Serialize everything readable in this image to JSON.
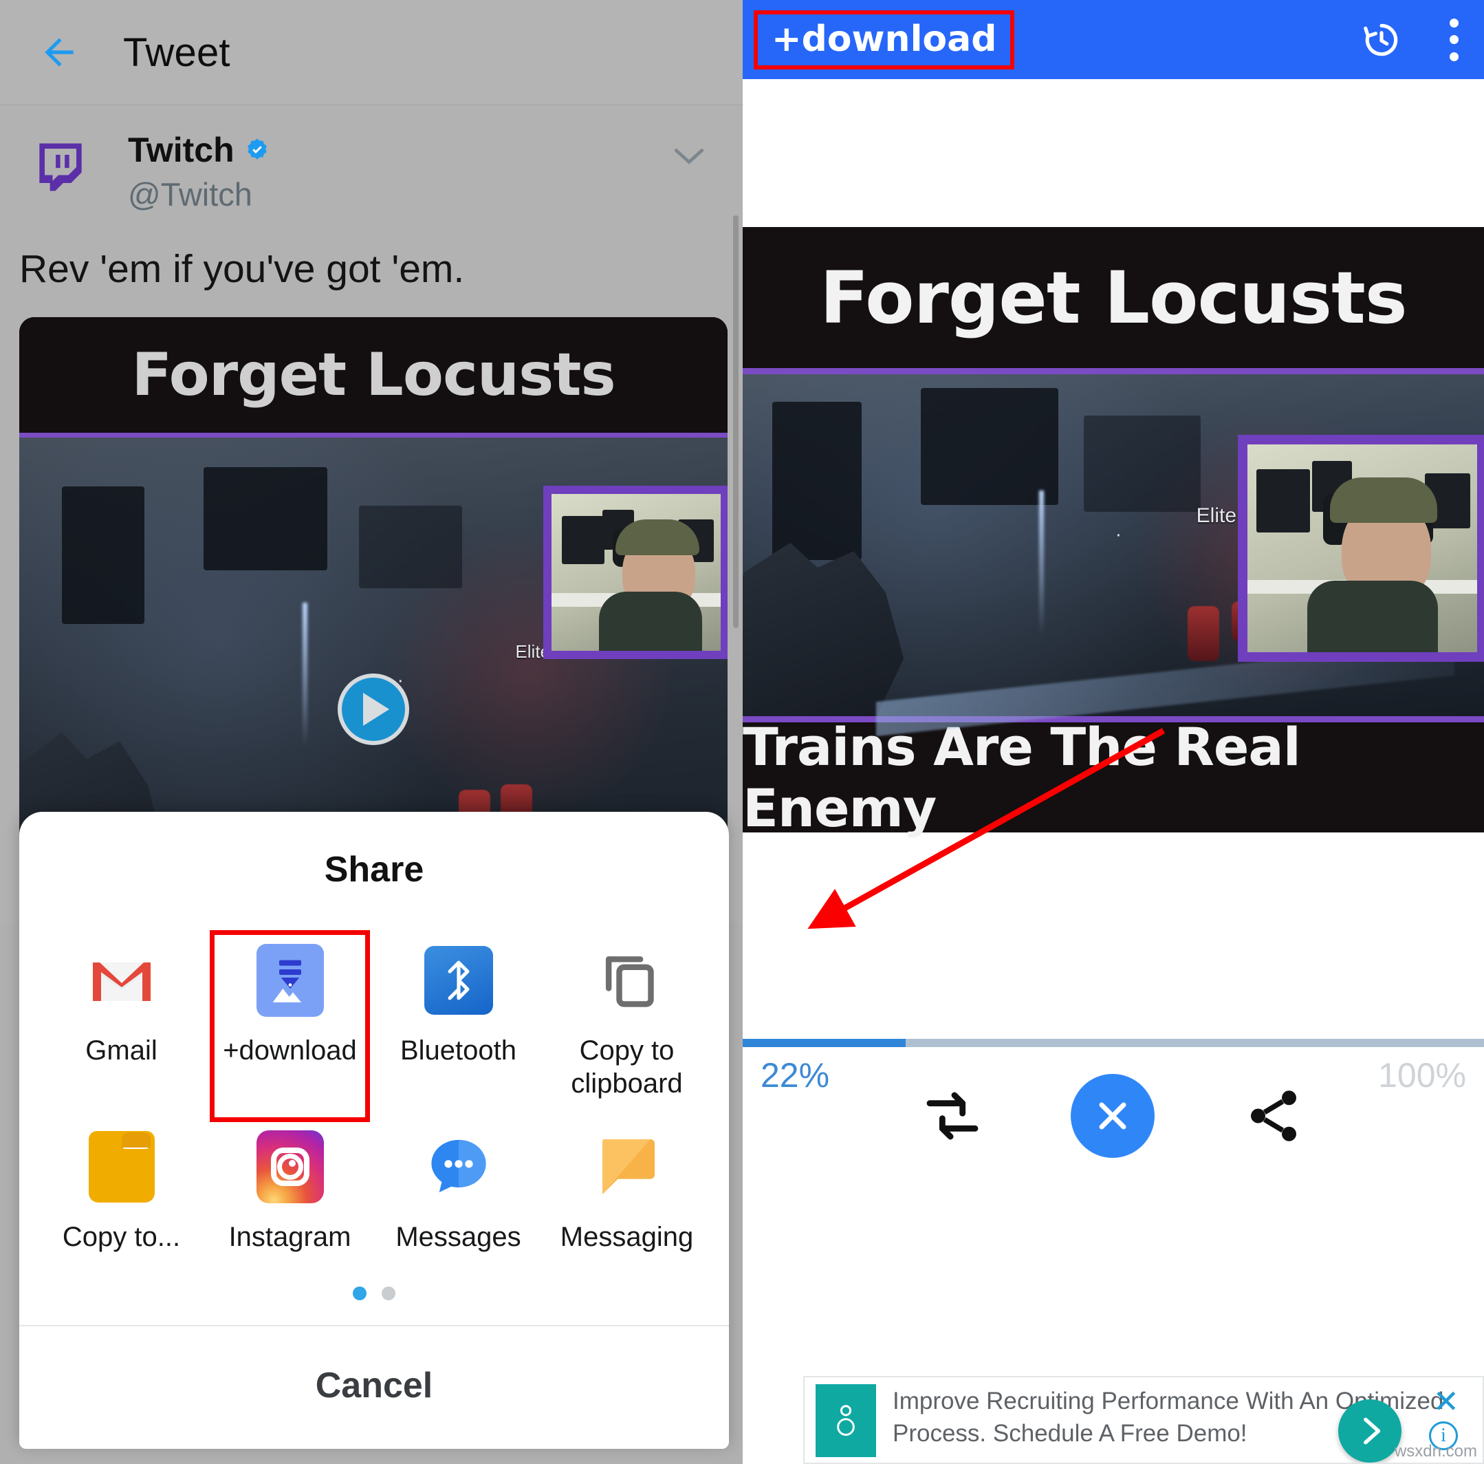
{
  "left_panel": {
    "appbar": {
      "back_icon": "back-arrow-icon",
      "title": "Tweet"
    },
    "tweet": {
      "avatar_icon": "twitch-logo-icon",
      "display_name": "Twitch",
      "verified_icon": "verified-badge-icon",
      "handle": "@Twitch",
      "overflow_icon": "chevron-down-icon",
      "text": "Rev 'em if you've got 'em.",
      "media": {
        "caption_top": "Forget Locusts",
        "overlay_label": "Elite D",
        "play_icon": "play-button-icon"
      }
    },
    "share_sheet": {
      "title": "Share",
      "items": [
        {
          "label": "Gmail",
          "icon": "gmail-icon",
          "highlighted": false
        },
        {
          "label": "+download",
          "icon": "plus-download-icon",
          "highlighted": true
        },
        {
          "label": "Bluetooth",
          "icon": "bluetooth-icon",
          "highlighted": false
        },
        {
          "label": "Copy to clipboard",
          "icon": "copy-to-clipboard-icon",
          "highlighted": false
        },
        {
          "label": "Copy to...",
          "icon": "folder-icon",
          "highlighted": false
        },
        {
          "label": "Instagram",
          "icon": "instagram-icon",
          "highlighted": false
        },
        {
          "label": "Messages",
          "icon": "messages-icon",
          "highlighted": false
        },
        {
          "label": "Messaging",
          "icon": "messaging-icon",
          "highlighted": false
        }
      ],
      "pagination": {
        "pages": 2,
        "active_index": 0
      },
      "cancel_label": "Cancel"
    }
  },
  "right_panel": {
    "appbar": {
      "title": "+download",
      "title_highlighted": true,
      "history_icon": "history-clock-icon",
      "menu_icon": "kebab-menu-icon"
    },
    "media": {
      "caption_top": "Forget Locusts",
      "caption_bottom": "Trains Are The Real Enemy",
      "overlay_label": "Elite D"
    },
    "download": {
      "progress_percent": 22,
      "progress_label": "22%",
      "total_label": "100%",
      "controls": [
        {
          "name": "retry-download-button",
          "icon": "retry-arrows-icon"
        },
        {
          "name": "cancel-download-button",
          "icon": "close-x-icon"
        },
        {
          "name": "share-download-button",
          "icon": "share-nodes-icon"
        }
      ]
    },
    "ad": {
      "text": "Improve Recruiting Performance With An Optimized Process. Schedule A Free Demo!",
      "logo_icon": "advertiser-logo-icon",
      "cta_icon": "chevron-right-icon",
      "close_icon": "ad-close-icon",
      "info_icon": "ad-info-icon"
    },
    "watermark": "wsxdn.com"
  },
  "colors": {
    "appbar_blue": "#2667fa",
    "annotation_red": "#f40000",
    "progress_blue": "#2f86d8",
    "twitch_purple": "#6f3fbd",
    "cancel_blue": "#2f87f7"
  }
}
